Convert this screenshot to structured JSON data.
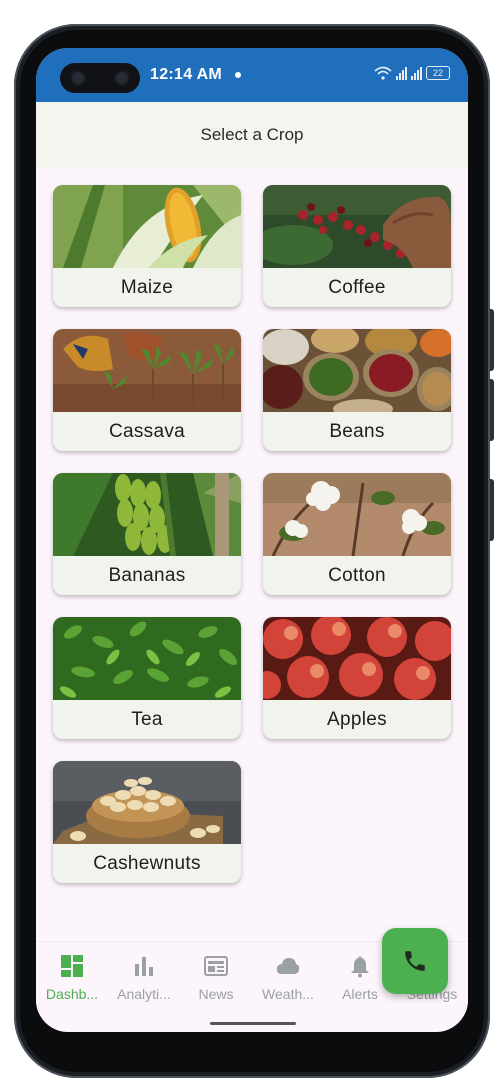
{
  "status": {
    "time": "12:14 AM",
    "battery": "22"
  },
  "topbar": {
    "title": "Select a Crop"
  },
  "crops": [
    {
      "label": "Maize"
    },
    {
      "label": "Coffee"
    },
    {
      "label": "Cassava"
    },
    {
      "label": "Beans"
    },
    {
      "label": "Bananas"
    },
    {
      "label": "Cotton"
    },
    {
      "label": "Tea"
    },
    {
      "label": "Apples"
    },
    {
      "label": "Cashewnuts"
    }
  ],
  "nav": [
    {
      "label": "Dashb...",
      "icon": "dashboard-icon"
    },
    {
      "label": "Analyti...",
      "icon": "bar-chart-icon"
    },
    {
      "label": "News",
      "icon": "newspaper-icon"
    },
    {
      "label": "Weath...",
      "icon": "cloud-icon"
    },
    {
      "label": "Alerts",
      "icon": "bell-icon"
    },
    {
      "label": "Settings",
      "icon": "gear-icon"
    }
  ],
  "colors": {
    "accent": "#4caf50",
    "statusbar": "#1f6fbc",
    "topbar": "#f3f6ee",
    "background": "#fdf5fc"
  },
  "fab": {
    "icon": "phone-icon"
  }
}
